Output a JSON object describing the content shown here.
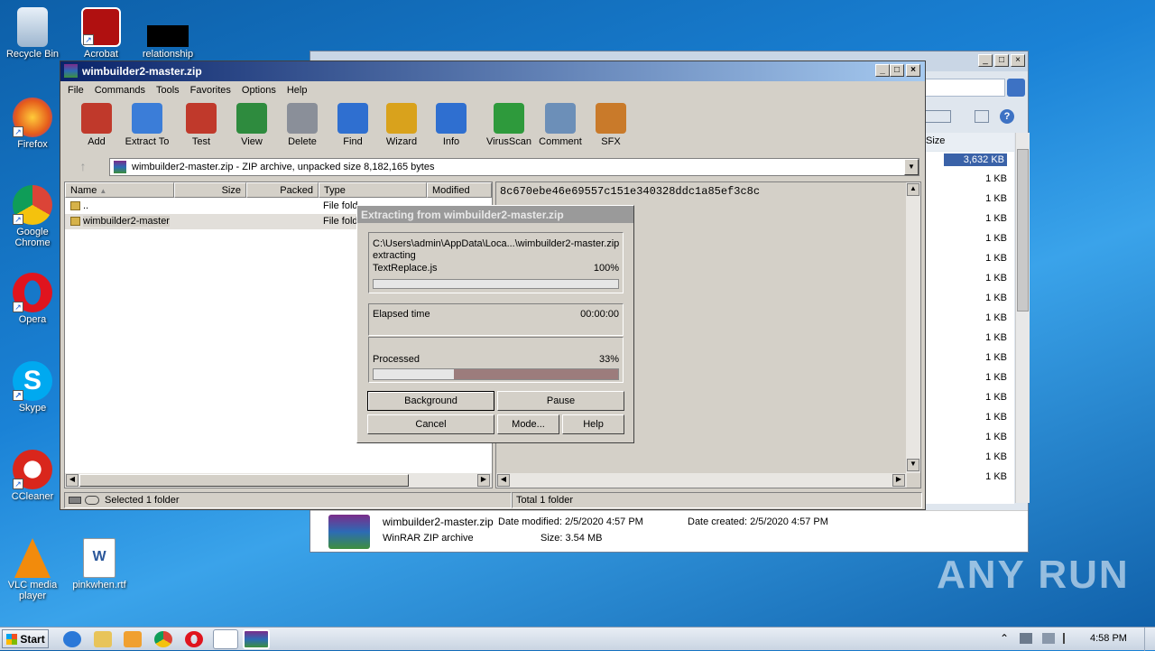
{
  "desktop": {
    "icons": [
      {
        "label": "Recycle Bin",
        "icon": "recycle-bin-icon"
      },
      {
        "label": "Acrobat",
        "icon": "acrobat-icon"
      },
      {
        "label": "relationship",
        "icon": "file-icon"
      },
      {
        "label": "Firefox",
        "icon": "firefox-icon"
      },
      {
        "label": "Google Chrome",
        "icon": "chrome-icon"
      },
      {
        "label": "Opera",
        "icon": "opera-icon"
      },
      {
        "label": "Skype",
        "icon": "skype-icon"
      },
      {
        "label": "CCleaner",
        "icon": "ccleaner-icon"
      },
      {
        "label": "VLC media player",
        "icon": "vlc-icon"
      },
      {
        "label": "pinkwhen.rtf",
        "icon": "word-document-icon"
      }
    ],
    "watermark": "ANY RUN"
  },
  "explorer": {
    "sizes": [
      "3,632 KB",
      "1 KB",
      "1 KB",
      "1 KB",
      "1 KB",
      "1 KB",
      "1 KB",
      "1 KB",
      "1 KB",
      "1 KB",
      "1 KB",
      "1 KB",
      "1 KB",
      "1 KB",
      "1 KB",
      "1 KB",
      "1 KB"
    ],
    "size_header": "Size",
    "details": {
      "name": "wimbuilder2-master.zip",
      "type": "WinRAR ZIP archive",
      "modified": "Date modified: 2/5/2020 4:57 PM",
      "created": "Date created: 2/5/2020 4:57 PM",
      "size": "Size: 3.54 MB"
    }
  },
  "winrar": {
    "title": "wimbuilder2-master.zip",
    "menu": [
      "File",
      "Commands",
      "Tools",
      "Favorites",
      "Options",
      "Help"
    ],
    "toolbar": [
      {
        "label": "Add",
        "icon": "add-archive-icon",
        "color": "#c0392b"
      },
      {
        "label": "Extract To",
        "icon": "extract-folder-icon",
        "color": "#3b7dd8"
      },
      {
        "label": "Test",
        "icon": "test-clipboard-icon",
        "color": "#c0392b"
      },
      {
        "label": "View",
        "icon": "view-book-icon",
        "color": "#2e8b3e"
      },
      {
        "label": "Delete",
        "icon": "delete-trash-icon",
        "color": "#8a8f99"
      },
      {
        "label": "Find",
        "icon": "find-magnifier-icon",
        "color": "#2f6fd0"
      },
      {
        "label": "Wizard",
        "icon": "wizard-wand-icon",
        "color": "#d9a21c"
      },
      {
        "label": "Info",
        "icon": "info-icon",
        "color": "#2f6fd0"
      },
      {
        "label": "VirusScan",
        "icon": "virusscan-bug-icon",
        "color": "#2e9a3c"
      },
      {
        "label": "Comment",
        "icon": "comment-icon",
        "color": "#6c8fb8"
      },
      {
        "label": "SFX",
        "icon": "sfx-box-icon",
        "color": "#c97a2a"
      }
    ],
    "path": "wimbuilder2-master.zip - ZIP archive, unpacked size 8,182,165 bytes",
    "columns": [
      "Name",
      "Size",
      "Packed",
      "Type",
      "Modified"
    ],
    "rows": [
      {
        "name": "..",
        "type": "File fold"
      },
      {
        "name": "wimbuilder2-master",
        "type": "File fold"
      }
    ],
    "comment": "8c670ebe46e69557c151e340328ddc1a85ef3c8c",
    "status_left": "Selected 1 folder",
    "status_right": "Total 1 folder"
  },
  "dialog": {
    "title": "Extracting from wimbuilder2-master.zip",
    "path": "C:\\Users\\admin\\AppData\\Loca...\\wimbuilder2-master.zip",
    "action": "extracting",
    "file": "TextReplace.js",
    "file_percent": "100%",
    "file_progress": 1.0,
    "elapsed_label": "Elapsed time",
    "elapsed_value": "00:00:00",
    "processed_label": "Processed",
    "processed_percent": "33%",
    "processed_progress": 0.33,
    "buttons": {
      "background": "Background",
      "pause": "Pause",
      "cancel": "Cancel",
      "mode": "Mode...",
      "help": "Help"
    }
  },
  "taskbar": {
    "start": "Start",
    "clock": "4:58 PM"
  }
}
